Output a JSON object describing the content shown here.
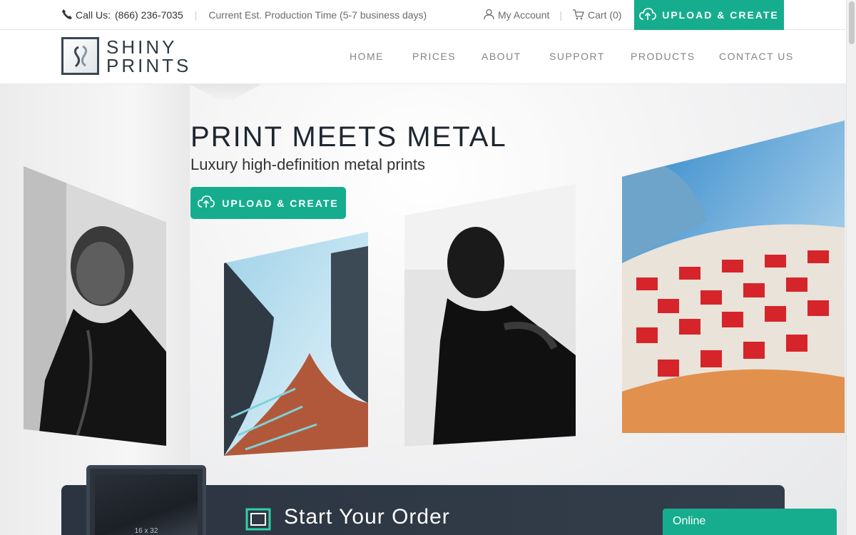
{
  "topbar": {
    "call_label": "Call Us:",
    "phone": "(866) 236-7035",
    "separator": "|",
    "production_time": "Current Est. Production Time (5-7 business days)",
    "my_account": "My Account",
    "cart": "Cart (0)",
    "upload_label": "UPLOAD & CREATE"
  },
  "header": {
    "logo_line1": "SHINY",
    "logo_line2": "PRINTS",
    "nav": [
      "HOME",
      "PRICES",
      "ABOUT",
      "SUPPORT",
      "PRODUCTS",
      "CONTACT US"
    ]
  },
  "hero": {
    "title": "PRINT MEETS METAL",
    "subtitle": "Luxury high-definition metal prints",
    "upload_label": "UPLOAD & CREATE"
  },
  "order": {
    "title": "Start Your Order",
    "device_size": "16 x 32"
  },
  "chat": {
    "status": "Online"
  },
  "colors": {
    "accent": "#16ad8e",
    "dark_panel": "#2b3440",
    "text_dark": "#1f2630",
    "nav_text": "#858585"
  }
}
